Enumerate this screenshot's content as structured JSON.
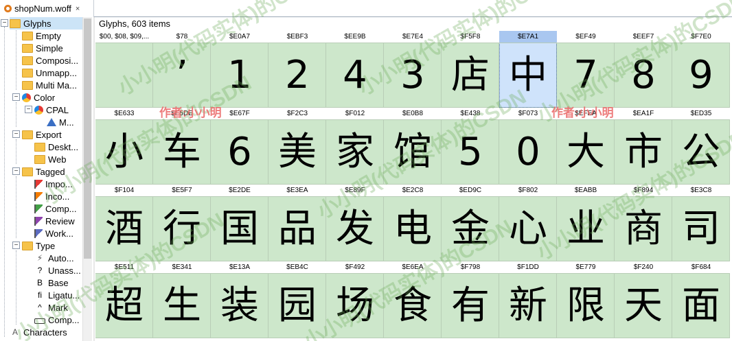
{
  "tab": {
    "title": "shopNum.woff",
    "close": "×"
  },
  "sidebar": {
    "items": [
      {
        "label": "Glyphs",
        "icon": "folder-icon"
      },
      {
        "label": "Empty",
        "icon": "folder-icon"
      },
      {
        "label": "Simple",
        "icon": "folder-icon"
      },
      {
        "label": "Composi...",
        "icon": "folder-icon"
      },
      {
        "label": "Unmapp...",
        "icon": "folder-icon"
      },
      {
        "label": "Multi Ma...",
        "icon": "folder-icon"
      },
      {
        "label": "Color",
        "icon": "palette-icon"
      },
      {
        "label": "CPAL",
        "icon": "palette-icon"
      },
      {
        "label": "M...",
        "icon": "triangle-icon"
      },
      {
        "label": "Export",
        "icon": "folder-icon"
      },
      {
        "label": "Deskt...",
        "icon": "folder-icon"
      },
      {
        "label": "Web",
        "icon": "folder-icon"
      },
      {
        "label": "Tagged",
        "icon": "folder-icon"
      },
      {
        "label": "Impo...",
        "icon": "flag-icon"
      },
      {
        "label": "Inco...",
        "icon": "flag-icon"
      },
      {
        "label": "Comp...",
        "icon": "flag-icon"
      },
      {
        "label": "Review",
        "icon": "flag-icon"
      },
      {
        "label": "Work...",
        "icon": "flag-icon"
      },
      {
        "label": "Type",
        "icon": "folder-icon"
      },
      {
        "label": "Auto...",
        "icon": "lightning-icon"
      },
      {
        "label": "Unass...",
        "icon": "question-icon"
      },
      {
        "label": "Base",
        "icon": "b-icon"
      },
      {
        "label": "Ligatu...",
        "icon": "fi-icon"
      },
      {
        "label": "Mark",
        "icon": "caret-icon"
      },
      {
        "label": "Comp...",
        "icon": "component-icon"
      },
      {
        "label": "Characters",
        "icon": "a-icon"
      }
    ],
    "glyph_a": "A",
    "glyph_b": "B",
    "glyph_fi": "fi",
    "glyph_q": "?",
    "glyph_caret": "^",
    "toggle_minus": "−"
  },
  "main": {
    "header": "Glyphs, 603 items",
    "rows": [
      [
        {
          "code": "$00, $08, $09,...",
          "glyph": ""
        },
        {
          "code": "$78",
          "glyph": "’"
        },
        {
          "code": "$E0A7",
          "glyph": "1"
        },
        {
          "code": "$EBF3",
          "glyph": "2"
        },
        {
          "code": "$EE9B",
          "glyph": "4"
        },
        {
          "code": "$E7E4",
          "glyph": "3"
        },
        {
          "code": "$F5F8",
          "glyph": "店"
        },
        {
          "code": "$E7A1",
          "glyph": "中"
        },
        {
          "code": "$EF49",
          "glyph": "7"
        },
        {
          "code": "$EEF7",
          "glyph": "8"
        },
        {
          "code": "$F7E0",
          "glyph": "9"
        }
      ],
      [
        {
          "code": "$E633",
          "glyph": "小"
        },
        {
          "code": "$E5DE",
          "glyph": "车"
        },
        {
          "code": "$E67F",
          "glyph": "6"
        },
        {
          "code": "$F2C3",
          "glyph": "美"
        },
        {
          "code": "$F012",
          "glyph": "家"
        },
        {
          "code": "$E0B8",
          "glyph": "馆"
        },
        {
          "code": "$E438",
          "glyph": "5"
        },
        {
          "code": "$F073",
          "glyph": "0"
        },
        {
          "code": "$EFEA",
          "glyph": "大"
        },
        {
          "code": "$EA1F",
          "glyph": "市"
        },
        {
          "code": "$ED35",
          "glyph": "公"
        }
      ],
      [
        {
          "code": "$F104",
          "glyph": "酒"
        },
        {
          "code": "$E5F7",
          "glyph": "行"
        },
        {
          "code": "$E2DE",
          "glyph": "国"
        },
        {
          "code": "$E3EA",
          "glyph": "品"
        },
        {
          "code": "$E89F",
          "glyph": "发"
        },
        {
          "code": "$E2C8",
          "glyph": "电"
        },
        {
          "code": "$ED9C",
          "glyph": "金"
        },
        {
          "code": "$F802",
          "glyph": "心"
        },
        {
          "code": "$EABB",
          "glyph": "业"
        },
        {
          "code": "$F894",
          "glyph": "商"
        },
        {
          "code": "$E3C8",
          "glyph": "司"
        }
      ],
      [
        {
          "code": "$E511",
          "glyph": "超"
        },
        {
          "code": "$E341",
          "glyph": "生"
        },
        {
          "code": "$E13A",
          "glyph": "装"
        },
        {
          "code": "$EB4C",
          "glyph": "园"
        },
        {
          "code": "$F492",
          "glyph": "场"
        },
        {
          "code": "$E6EA",
          "glyph": "食"
        },
        {
          "code": "$F798",
          "glyph": "有"
        },
        {
          "code": "$F1DD",
          "glyph": "新"
        },
        {
          "code": "$E779",
          "glyph": "限"
        },
        {
          "code": "$F240",
          "glyph": "天"
        },
        {
          "code": "$F684",
          "glyph": "面"
        }
      ]
    ]
  },
  "watermarks": {
    "text": "小小明(代码实体)的CSDN",
    "author": "作者:小小明"
  },
  "colors": {
    "cell_bg": "#cde7cb",
    "selected_bg": "#cfe3fb",
    "author_color": "#eb6e6e"
  }
}
